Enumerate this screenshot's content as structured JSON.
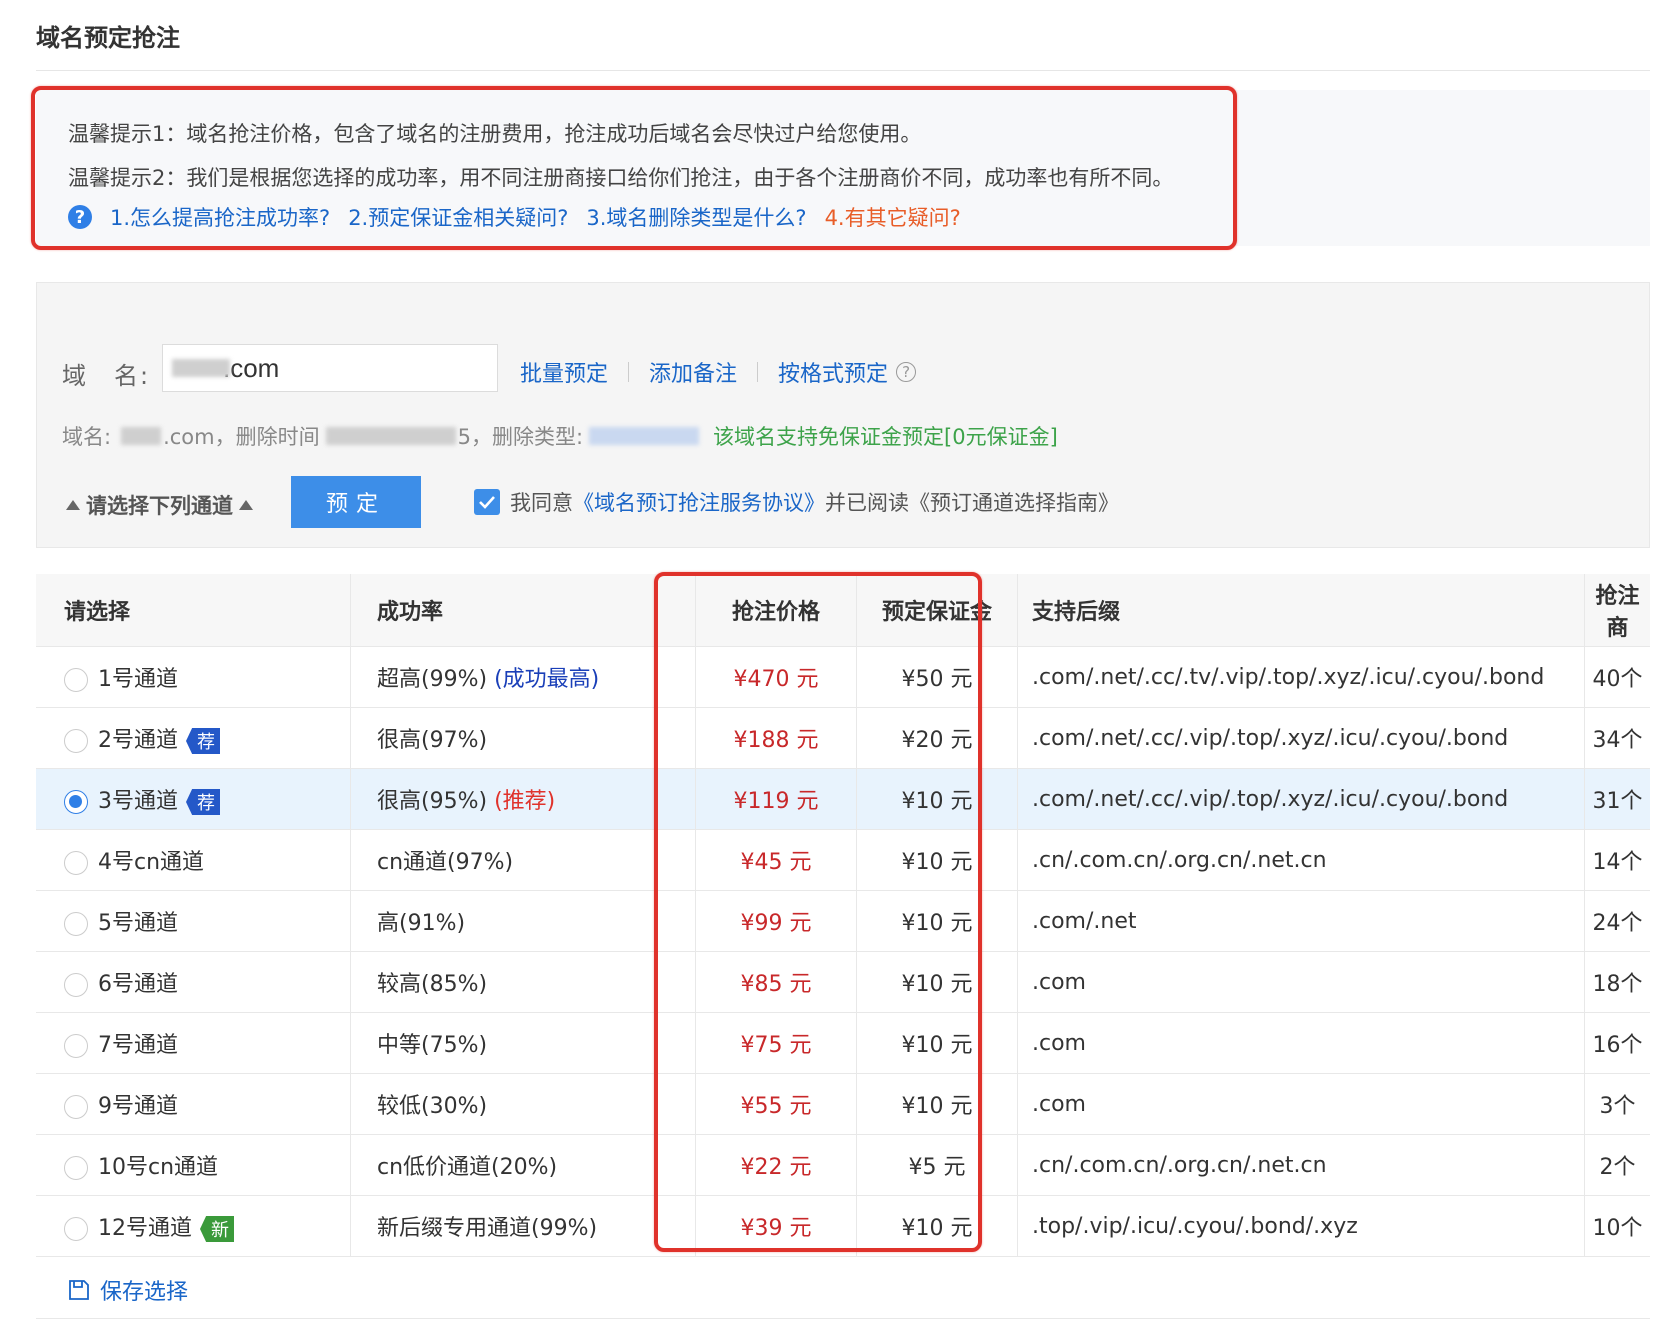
{
  "page": {
    "title": "域名预定抢注"
  },
  "tips": {
    "tip1": "温馨提示1：域名抢注价格，包含了域名的注册费用，抢注成功后域名会尽快过户给您使用。",
    "tip2": "温馨提示2：我们是根据您选择的成功率，用不同注册商接口给你们抢注，由于各个注册商价不同，成功率也有所不同。",
    "faq": [
      {
        "label": "1.怎么提高抢注成功率?"
      },
      {
        "label": "2.预定保证金相关疑问?"
      },
      {
        "label": "3.域名删除类型是什么?"
      },
      {
        "label": "4.有其它疑问?"
      }
    ]
  },
  "form": {
    "domain_label": "域　名:",
    "domain_value": ".com",
    "links": {
      "batch": "批量预定",
      "note": "添加备注",
      "format": "按格式预定"
    },
    "info": {
      "domain_prefix": "域名:",
      "domain_suffix": ".com，",
      "delete_time_label": "删除时间",
      "delete_time_suffix": "5，",
      "delete_type_label": "删除类型:",
      "free_deposit": "该域名支持免保证金预定[0元保证金]"
    },
    "select_channels": "请选择下列通道",
    "book_button": "预定",
    "agree": {
      "prefix": "我同意",
      "protocol": "《域名预订抢注服务协议》",
      "middle": "并已阅读",
      "guide": "《预订通道选择指南》"
    }
  },
  "table": {
    "headers": {
      "select": "请选择",
      "rate": "成功率",
      "price": "抢注价格",
      "deposit": "预定保证金",
      "suffix": "支持后缀",
      "registrar": "抢注商"
    },
    "rows": [
      {
        "name": "1号通道",
        "badge": "",
        "rate": "超高(99%)",
        "note": "(成功最高)",
        "price": "¥470 元",
        "deposit": "¥50 元",
        "suffix": ".com/.net/.cc/.tv/.vip/.top/.xyz/.icu/.cyou/.bond",
        "registrar": "40个"
      },
      {
        "name": "2号通道",
        "badge": "荐",
        "rate": "很高(97%)",
        "note": "",
        "price": "¥188 元",
        "deposit": "¥20 元",
        "suffix": ".com/.net/.cc/.vip/.top/.xyz/.icu/.cyou/.bond",
        "registrar": "34个"
      },
      {
        "name": "3号通道",
        "badge": "荐",
        "rate": "很高(95%)",
        "note": "(推荐)",
        "price": "¥119 元",
        "deposit": "¥10 元",
        "suffix": ".com/.net/.cc/.vip/.top/.xyz/.icu/.cyou/.bond",
        "registrar": "31个"
      },
      {
        "name": "4号cn通道",
        "badge": "",
        "rate": "cn通道(97%)",
        "note": "",
        "price": "¥45 元",
        "deposit": "¥10 元",
        "suffix": ".cn/.com.cn/.org.cn/.net.cn",
        "registrar": "14个"
      },
      {
        "name": "5号通道",
        "badge": "",
        "rate": "高(91%)",
        "note": "",
        "price": "¥99 元",
        "deposit": "¥10 元",
        "suffix": ".com/.net",
        "registrar": "24个"
      },
      {
        "name": "6号通道",
        "badge": "",
        "rate": "较高(85%)",
        "note": "",
        "price": "¥85 元",
        "deposit": "¥10 元",
        "suffix": ".com",
        "registrar": "18个"
      },
      {
        "name": "7号通道",
        "badge": "",
        "rate": "中等(75%)",
        "note": "",
        "price": "¥75 元",
        "deposit": "¥10 元",
        "suffix": ".com",
        "registrar": "16个"
      },
      {
        "name": "9号通道",
        "badge": "",
        "rate": "较低(30%)",
        "note": "",
        "price": "¥55 元",
        "deposit": "¥10 元",
        "suffix": ".com",
        "registrar": "3个"
      },
      {
        "name": "10号cn通道",
        "badge": "",
        "rate": "cn低价通道(20%)",
        "note": "",
        "price": "¥22 元",
        "deposit": "¥5 元",
        "suffix": ".cn/.com.cn/.org.cn/.net.cn",
        "registrar": "2个"
      },
      {
        "name": "12号通道",
        "badge": "新",
        "rate": "新后缀专用通道(99%)",
        "note": "",
        "price": "¥39 元",
        "deposit": "¥10 元",
        "suffix": ".top/.vip/.icu/.cyou/.bond/.xyz",
        "registrar": "10个"
      }
    ],
    "selected_index": 2
  },
  "save": {
    "label": "保存选择",
    "icon": "save-icon"
  },
  "colors": {
    "accent": "#3d8ee8",
    "link": "#1a66c8",
    "price": "#c8282a",
    "highlight_border": "#e0322b",
    "free_text": "#3da34a"
  }
}
